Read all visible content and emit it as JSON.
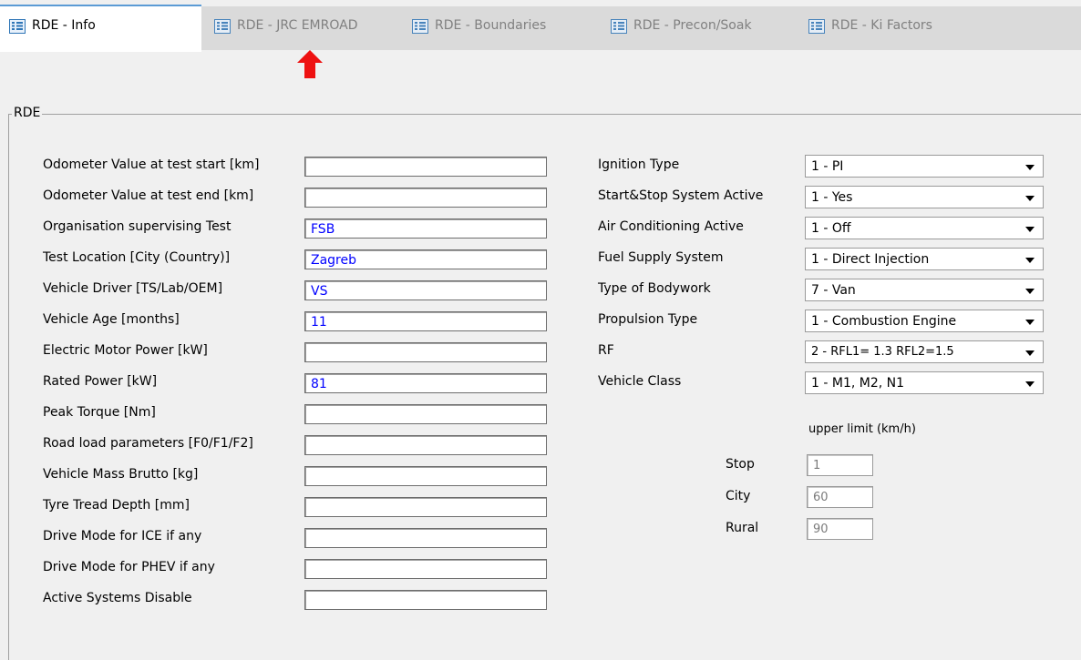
{
  "tabs": [
    {
      "label": "RDE - Info",
      "active": true
    },
    {
      "label": "RDE - JRC EMROAD",
      "active": false
    },
    {
      "label": "RDE - Boundaries",
      "active": false
    },
    {
      "label": "RDE - Precon/Soak",
      "active": false
    },
    {
      "label": "RDE - Ki Factors",
      "active": false
    }
  ],
  "group_title": "RDE",
  "left_fields": [
    {
      "label": "Odometer Value at test start [km]",
      "value": ""
    },
    {
      "label": "Odometer Value at test end [km]",
      "value": ""
    },
    {
      "label": "Organisation supervising Test",
      "value": "FSB"
    },
    {
      "label": "Test Location [City (Country)]",
      "value": "Zagreb"
    },
    {
      "label": "Vehicle Driver [TS/Lab/OEM]",
      "value": "VS"
    },
    {
      "label": "Vehicle Age [months]",
      "value": "11"
    },
    {
      "label": "Electric Motor Power [kW]",
      "value": ""
    },
    {
      "label": "Rated Power [kW]",
      "value": "81"
    },
    {
      "label": "Peak Torque [Nm]",
      "value": ""
    },
    {
      "label": "Road load parameters [F0/F1/F2]",
      "value": ""
    },
    {
      "label": "Vehicle Mass Brutto [kg]",
      "value": ""
    },
    {
      "label": "Tyre Tread Depth [mm]",
      "value": ""
    },
    {
      "label": "Drive Mode for ICE if any",
      "value": ""
    },
    {
      "label": "Drive Mode for PHEV if any",
      "value": ""
    },
    {
      "label": "Active Systems Disable",
      "value": ""
    }
  ],
  "right_fields": [
    {
      "label": "Ignition Type",
      "value": "1 - PI"
    },
    {
      "label": "Start&Stop System Active",
      "value": "1 - Yes"
    },
    {
      "label": "Air Conditioning Active",
      "value": "1 - Off"
    },
    {
      "label": "Fuel Supply System",
      "value": "1 - Direct Injection"
    },
    {
      "label": "Type of Bodywork",
      "value": "7 - Van"
    },
    {
      "label": "Propulsion Type",
      "value": "1 - Combustion Engine"
    },
    {
      "label": "RF",
      "value": "2 -  RFL1= 1.3  RFL2=1.5"
    },
    {
      "label": "Vehicle Class",
      "value": "1 - M1, M2, N1"
    }
  ],
  "limits": {
    "header": "upper limit (km/h)",
    "rows": [
      {
        "label": "Stop",
        "value": "1"
      },
      {
        "label": "City",
        "value": "60"
      },
      {
        "label": "Rural",
        "value": "90"
      }
    ]
  }
}
